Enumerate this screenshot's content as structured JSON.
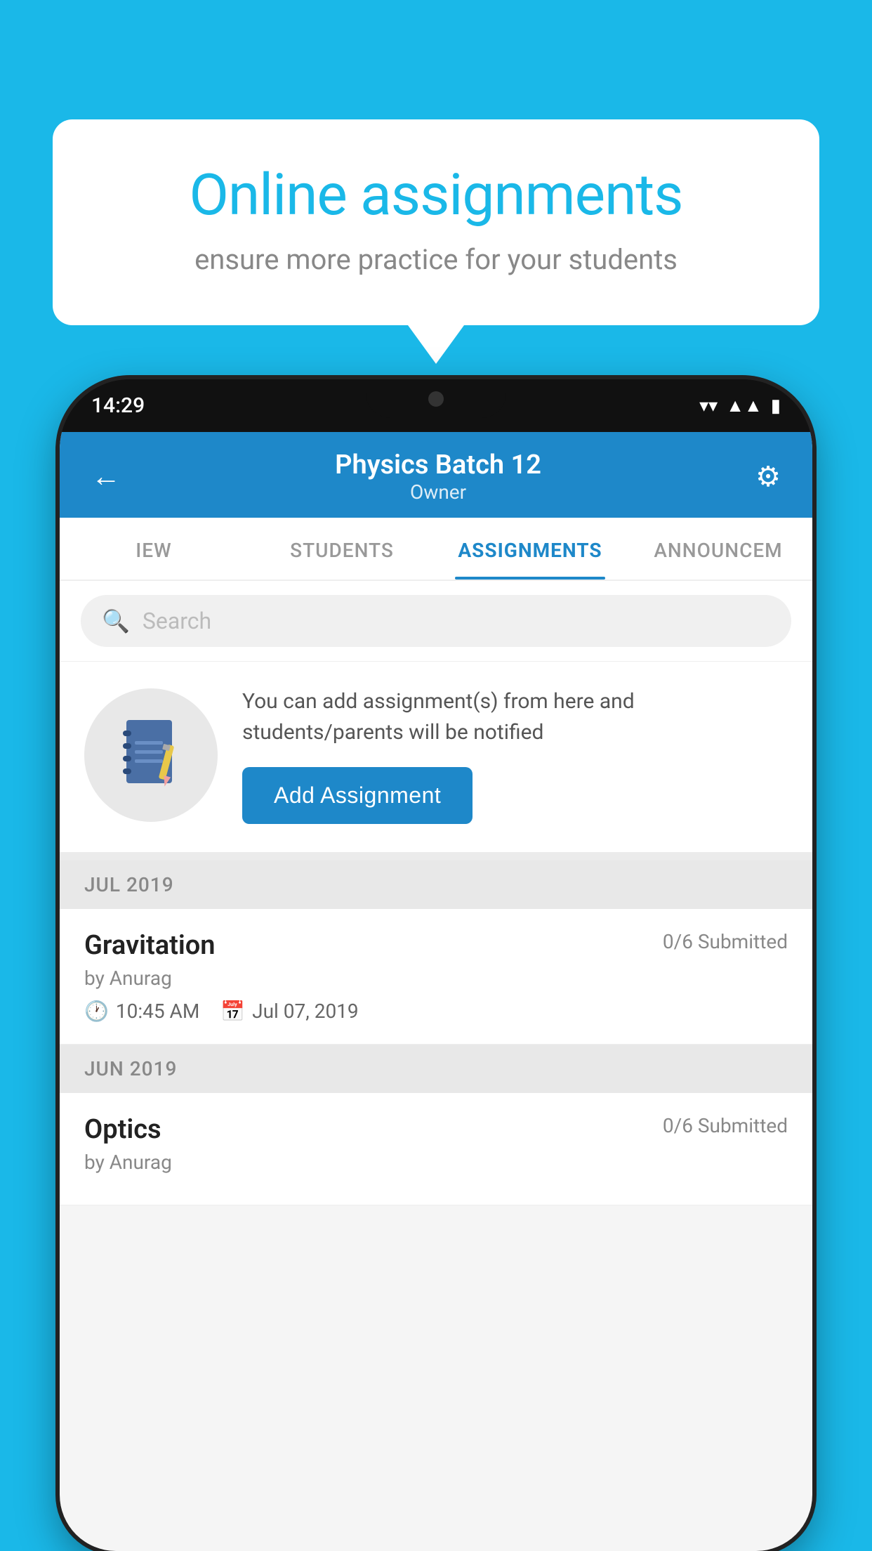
{
  "background": {
    "color": "#1ab8e8"
  },
  "speech_bubble": {
    "heading": "Online assignments",
    "subtext": "ensure more practice for your students"
  },
  "phone": {
    "status_bar": {
      "time": "14:29",
      "icons": [
        "wifi",
        "signal",
        "battery"
      ]
    },
    "header": {
      "back_label": "←",
      "title": "Physics Batch 12",
      "subtitle": "Owner",
      "settings_label": "⚙"
    },
    "tabs": [
      {
        "label": "IEW",
        "active": false
      },
      {
        "label": "STUDENTS",
        "active": false
      },
      {
        "label": "ASSIGNMENTS",
        "active": true
      },
      {
        "label": "ANNOUNCEM",
        "active": false
      }
    ],
    "search": {
      "placeholder": "Search"
    },
    "info_section": {
      "description": "You can add assignment(s) from here and students/parents will be notified",
      "button_label": "Add Assignment"
    },
    "assignments": [
      {
        "section": "JUL 2019",
        "items": [
          {
            "name": "Gravitation",
            "submitted": "0/6 Submitted",
            "by": "by Anurag",
            "time": "10:45 AM",
            "date": "Jul 07, 2019"
          }
        ]
      },
      {
        "section": "JUN 2019",
        "items": [
          {
            "name": "Optics",
            "submitted": "0/6 Submitted",
            "by": "by Anurag",
            "time": "",
            "date": ""
          }
        ]
      }
    ]
  }
}
